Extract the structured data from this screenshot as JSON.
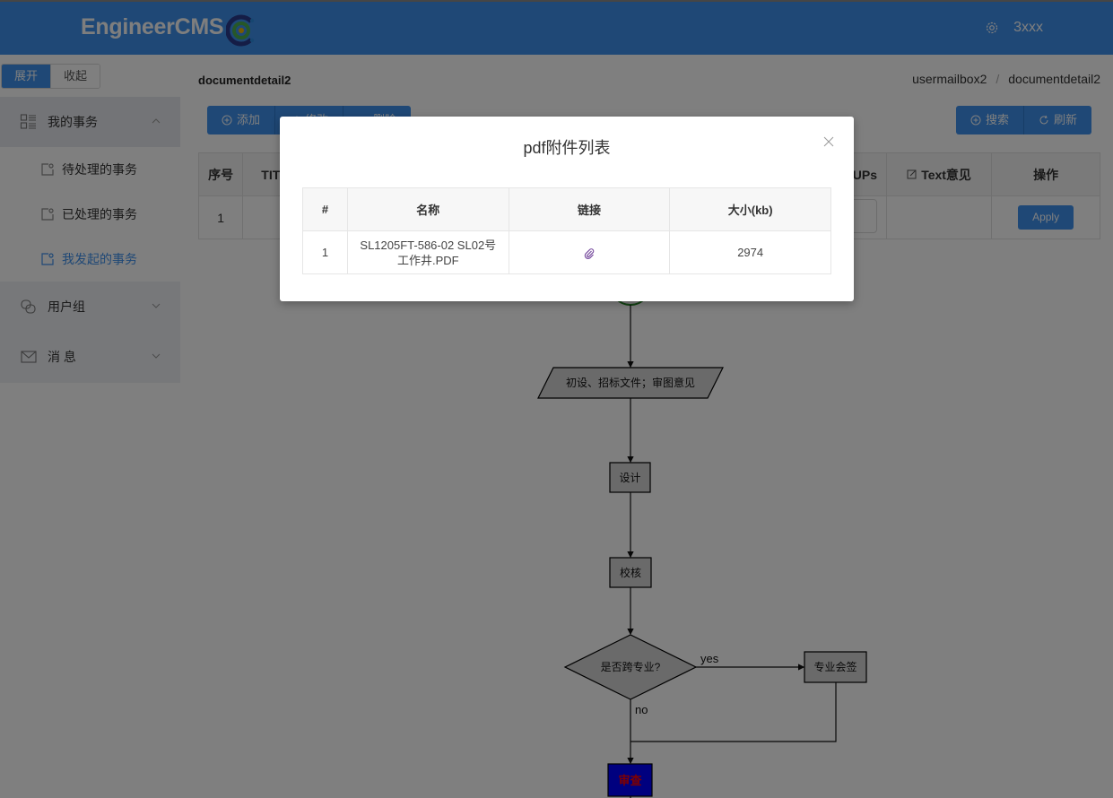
{
  "header": {
    "brand": "EngineerCMS",
    "user_name": "3xxx",
    "icons": {
      "settings": "gear-icon"
    },
    "colors": {
      "primary": "#3f91ed"
    }
  },
  "sidebar_toggle": {
    "expand": "展开",
    "collapse": "收起"
  },
  "sidebar": {
    "groups": [
      {
        "label": "我的事务",
        "icon": "task-list-icon",
        "expanded": true,
        "items": [
          {
            "label": "待处理的事务",
            "selected": false
          },
          {
            "label": "已处理的事务",
            "selected": false
          },
          {
            "label": "我发起的事务",
            "selected": true
          }
        ]
      },
      {
        "label": "用户组",
        "icon": "user-group-icon",
        "expanded": false
      },
      {
        "label": "消 息",
        "icon": "mail-icon",
        "expanded": false
      }
    ]
  },
  "page": {
    "title": "documentdetail2",
    "breadcrumb": [
      "usermailbox2",
      "documentdetail2"
    ],
    "breadcrumb_separator": "/"
  },
  "toolbar": {
    "left": [
      {
        "label": "添加",
        "icon": "plus-circle-icon"
      },
      {
        "label": "修改",
        "icon": "edit-icon"
      },
      {
        "label": "删除",
        "icon": "delete-icon"
      }
    ],
    "right": [
      {
        "label": "搜索",
        "icon": "plus-circle-icon"
      },
      {
        "label": "刷新",
        "icon": "refresh-icon"
      }
    ]
  },
  "table": {
    "columns": [
      "序号",
      "TITLE",
      "GROUPs",
      "Text意见",
      "操作"
    ],
    "rows": [
      {
        "index": "1",
        "action": "Apply"
      }
    ]
  },
  "flowchart": {
    "nodes": {
      "input": "初设、招标文件；审图意见",
      "design": "设计",
      "check": "校核",
      "decision": "是否跨专业?",
      "countersign": "专业会签",
      "review": "审查"
    },
    "edges": {
      "yes": "yes",
      "no": "no"
    }
  },
  "modal": {
    "title": "pdf附件列表",
    "columns": [
      "#",
      "名称",
      "链接",
      "大小(kb)"
    ],
    "rows": [
      {
        "index": "1",
        "name": "SL1205FT-586-02 SL02号工作井.PDF",
        "link_icon": "paperclip-icon",
        "size": "2974"
      }
    ]
  }
}
